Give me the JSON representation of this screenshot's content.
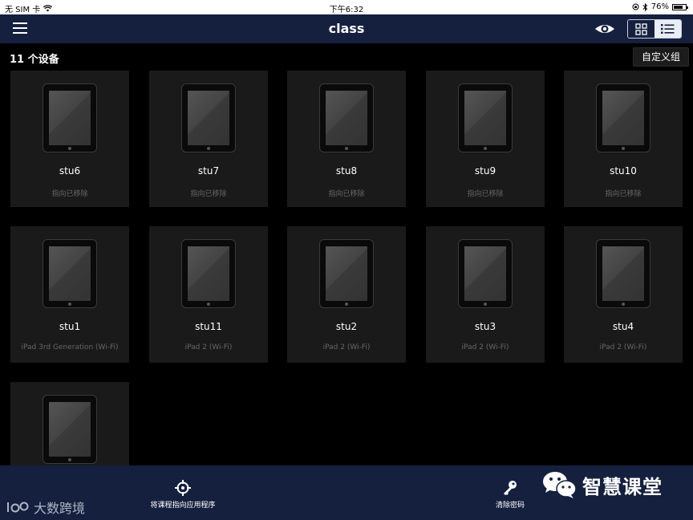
{
  "status_bar": {
    "carrier": "无 SIM 卡",
    "time": "下午6:32",
    "battery": "76%",
    "battery_level": 0.76
  },
  "nav": {
    "title": "class"
  },
  "device_count": "11 个设备",
  "custom_group_label": "自定义组",
  "devices": [
    {
      "name": "stu6",
      "subtitle": "指向已移除"
    },
    {
      "name": "stu7",
      "subtitle": "指向已移除"
    },
    {
      "name": "stu8",
      "subtitle": "指向已移除"
    },
    {
      "name": "stu9",
      "subtitle": "指向已移除"
    },
    {
      "name": "stu10",
      "subtitle": "指向已移除"
    },
    {
      "name": "stu1",
      "subtitle": "iPad 3rd Generation (Wi-Fi)"
    },
    {
      "name": "stu11",
      "subtitle": "iPad 2 (Wi-Fi)"
    },
    {
      "name": "stu2",
      "subtitle": "iPad 2 (Wi-Fi)"
    },
    {
      "name": "stu3",
      "subtitle": "iPad 2 (Wi-Fi)"
    },
    {
      "name": "stu4",
      "subtitle": "iPad 2 (Wi-Fi)"
    },
    {
      "name": "",
      "subtitle": ""
    }
  ],
  "tab_bar": {
    "point_label": "将课程指向应用程序",
    "clear_password_label": "清除密码"
  },
  "watermark": {
    "brand": "大数跨境",
    "wechat": "智慧课堂"
  },
  "icons": {
    "menu": "menu-icon",
    "eye": "eye-icon",
    "grid": "grid-view-icon",
    "list": "list-view-icon",
    "target": "crosshair-icon",
    "key": "key-icon"
  }
}
